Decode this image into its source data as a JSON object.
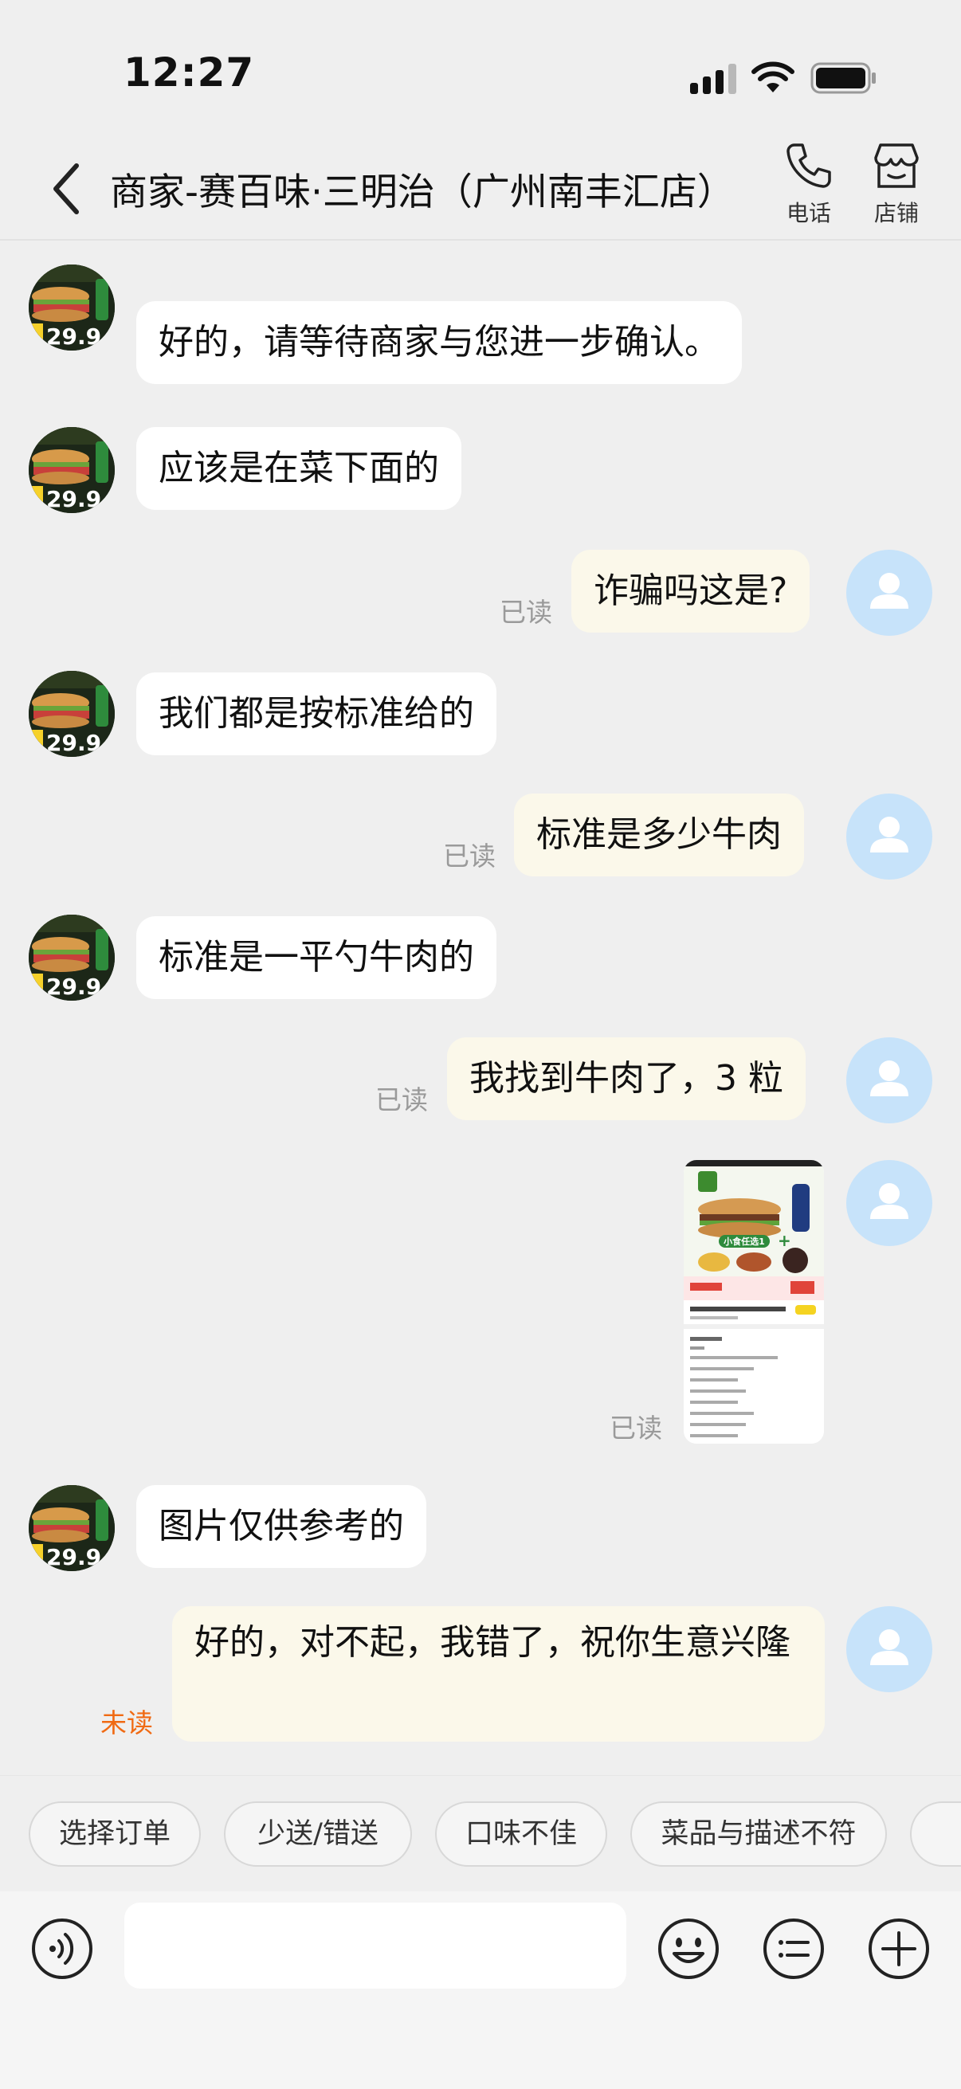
{
  "status_bar": {
    "time": "12:27"
  },
  "header": {
    "title": "商家-赛百味·三明治（广州南丰汇店）",
    "phone_label": "电话",
    "store_label": "店铺"
  },
  "shop_avatar": {
    "price_text": "29.9"
  },
  "messages": [
    {
      "from": "shop",
      "text": "好的，请等待商家与您进一步确认。"
    },
    {
      "from": "shop",
      "text": "应该是在菜下面的"
    },
    {
      "from": "me",
      "text": "诈骗吗这是?",
      "status": "已读"
    },
    {
      "from": "shop",
      "text": "我们都是按标准给的"
    },
    {
      "from": "me",
      "text": "标准是多少牛肉",
      "status": "已读"
    },
    {
      "from": "shop",
      "text": "标准是一平勺牛肉的"
    },
    {
      "from": "me",
      "text": "我找到牛肉了，3 粒",
      "status": "已读"
    },
    {
      "from": "me",
      "type": "image",
      "status": "已读",
      "image_banner": "小食任选1"
    },
    {
      "from": "shop",
      "text": "图片仅供参考的"
    },
    {
      "from": "me",
      "text": "好的，对不起，我错了，祝你生意兴隆",
      "status": "未读"
    }
  ],
  "quick_replies": [
    "选择订单",
    "少送/错送",
    "口味不佳",
    "菜品与描述不符"
  ],
  "input": {
    "value": "",
    "placeholder": ""
  },
  "colors": {
    "background": "#efefef",
    "my_bubble": "#fbf8ea",
    "shop_bubble": "#ffffff",
    "unread": "#f06a13",
    "read": "#9a9a9a",
    "user_avatar": "#c7e3fa"
  }
}
